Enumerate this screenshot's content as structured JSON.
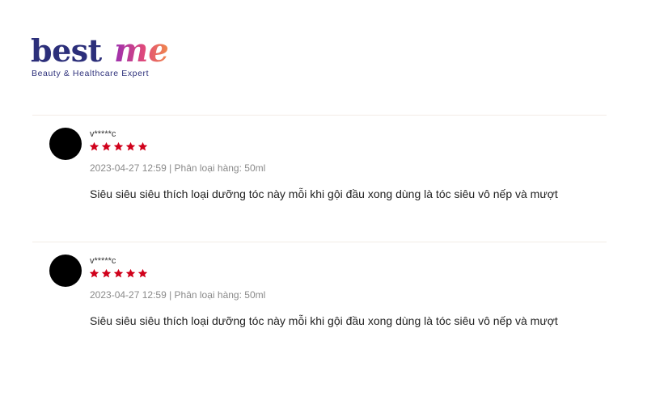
{
  "brand": {
    "name_part1": "best",
    "name_part2": "me",
    "tagline": "Beauty & Healthcare Expert",
    "colors": {
      "navy": "#2c2f7a",
      "gradient_start": "#9b2fb0",
      "gradient_end": "#f08a4b"
    }
  },
  "reviews": [
    {
      "username": "v*****c",
      "rating": 5,
      "meta": "2023-04-27 12:59 | Phân loại hàng: 50ml",
      "content": "Siêu siêu siêu thích loại dưỡng tóc này mỗi khi gội đầu xong dùng là tóc siêu vô nếp và mượt"
    },
    {
      "username": "v*****c",
      "rating": 5,
      "meta": "2023-04-27 12:59 | Phân loại hàng: 50ml",
      "content": "Siêu siêu siêu thích loại dưỡng tóc này mỗi khi gội đầu xong dùng là tóc siêu vô nếp và mượt"
    }
  ],
  "colors": {
    "star": "#d0011b",
    "avatar": "#000000",
    "divider": "#f3ece6"
  }
}
